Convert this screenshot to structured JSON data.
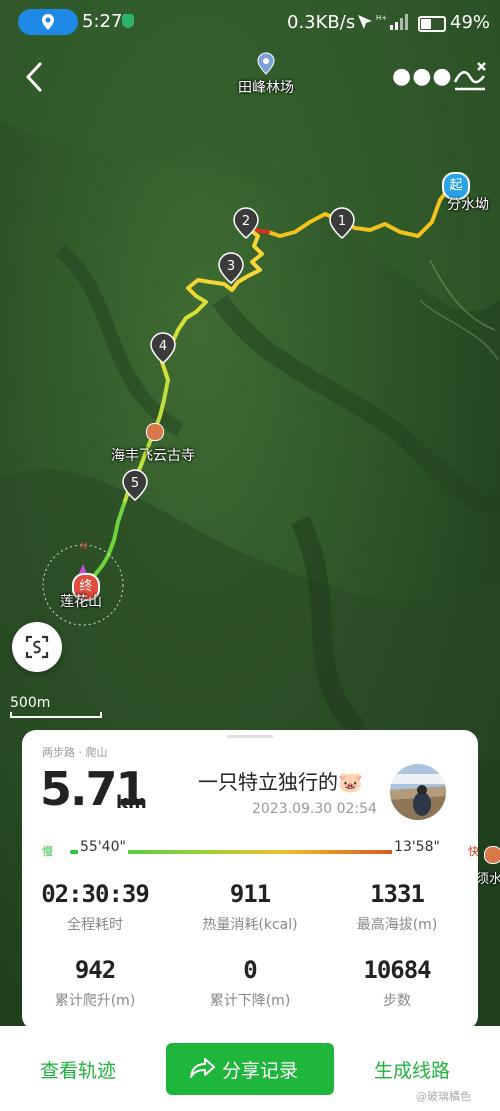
{
  "status_bar": {
    "time": "5:27",
    "network_speed": "0.3KB/s",
    "network_extra": "H+",
    "battery": "49%"
  },
  "map": {
    "top_place": "田峰林场",
    "start_marker": "起",
    "start_place": "分水坳",
    "temple": "海丰飞云古寺",
    "end_marker": "终",
    "end_place": "莲花山",
    "compass": "N",
    "km_markers": [
      "1",
      "2",
      "3",
      "4",
      "5"
    ],
    "scale": "500m",
    "edge_place": "须水"
  },
  "card": {
    "sport_type": "两步路 · 爬山",
    "distance": "5.71",
    "distance_unit": "km",
    "username": "一只特立独行的🐷",
    "datetime": "2023.09.30 02:54",
    "pace": {
      "slow_label": "慢",
      "fast_label": "快",
      "slowest": "55'40\"",
      "fastest": "13'58\""
    },
    "stats": [
      {
        "value": "02:30:39",
        "label": "全程耗时"
      },
      {
        "value": "911",
        "label": "热量消耗(kcal)"
      },
      {
        "value": "1331",
        "label": "最高海拔(m)"
      },
      {
        "value": "942",
        "label": "累计爬升(m)"
      },
      {
        "value": "0",
        "label": "累计下降(m)"
      },
      {
        "value": "10684",
        "label": "步数"
      }
    ]
  },
  "bottom_bar": {
    "view_track": "查看轨迹",
    "share": "分享记录",
    "generate_route": "生成线路",
    "watermark": "@玻璃橘色"
  },
  "colors": {
    "accent": "#1fb63c",
    "pace_slow": "#2fc344",
    "pace_fast": "#d23a1a"
  }
}
